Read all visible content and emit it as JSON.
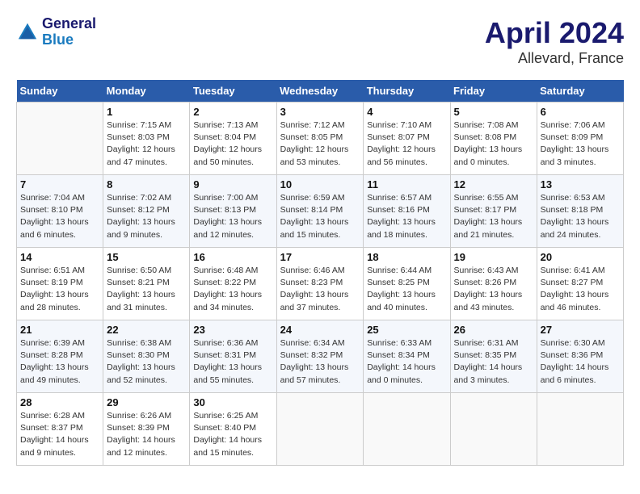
{
  "header": {
    "logo_line1": "General",
    "logo_line2": "Blue",
    "title": "April 2024",
    "subtitle": "Allevard, France"
  },
  "days_of_week": [
    "Sunday",
    "Monday",
    "Tuesday",
    "Wednesday",
    "Thursday",
    "Friday",
    "Saturday"
  ],
  "weeks": [
    [
      {
        "day": "",
        "empty": true
      },
      {
        "day": "1",
        "sunrise": "7:15 AM",
        "sunset": "8:03 PM",
        "daylight": "Daylight: 12 hours and 47 minutes."
      },
      {
        "day": "2",
        "sunrise": "7:13 AM",
        "sunset": "8:04 PM",
        "daylight": "Daylight: 12 hours and 50 minutes."
      },
      {
        "day": "3",
        "sunrise": "7:12 AM",
        "sunset": "8:05 PM",
        "daylight": "Daylight: 12 hours and 53 minutes."
      },
      {
        "day": "4",
        "sunrise": "7:10 AM",
        "sunset": "8:07 PM",
        "daylight": "Daylight: 12 hours and 56 minutes."
      },
      {
        "day": "5",
        "sunrise": "7:08 AM",
        "sunset": "8:08 PM",
        "daylight": "Daylight: 13 hours and 0 minutes."
      },
      {
        "day": "6",
        "sunrise": "7:06 AM",
        "sunset": "8:09 PM",
        "daylight": "Daylight: 13 hours and 3 minutes."
      }
    ],
    [
      {
        "day": "7",
        "sunrise": "7:04 AM",
        "sunset": "8:10 PM",
        "daylight": "Daylight: 13 hours and 6 minutes."
      },
      {
        "day": "8",
        "sunrise": "7:02 AM",
        "sunset": "8:12 PM",
        "daylight": "Daylight: 13 hours and 9 minutes."
      },
      {
        "day": "9",
        "sunrise": "7:00 AM",
        "sunset": "8:13 PM",
        "daylight": "Daylight: 13 hours and 12 minutes."
      },
      {
        "day": "10",
        "sunrise": "6:59 AM",
        "sunset": "8:14 PM",
        "daylight": "Daylight: 13 hours and 15 minutes."
      },
      {
        "day": "11",
        "sunrise": "6:57 AM",
        "sunset": "8:16 PM",
        "daylight": "Daylight: 13 hours and 18 minutes."
      },
      {
        "day": "12",
        "sunrise": "6:55 AM",
        "sunset": "8:17 PM",
        "daylight": "Daylight: 13 hours and 21 minutes."
      },
      {
        "day": "13",
        "sunrise": "6:53 AM",
        "sunset": "8:18 PM",
        "daylight": "Daylight: 13 hours and 24 minutes."
      }
    ],
    [
      {
        "day": "14",
        "sunrise": "6:51 AM",
        "sunset": "8:19 PM",
        "daylight": "Daylight: 13 hours and 28 minutes."
      },
      {
        "day": "15",
        "sunrise": "6:50 AM",
        "sunset": "8:21 PM",
        "daylight": "Daylight: 13 hours and 31 minutes."
      },
      {
        "day": "16",
        "sunrise": "6:48 AM",
        "sunset": "8:22 PM",
        "daylight": "Daylight: 13 hours and 34 minutes."
      },
      {
        "day": "17",
        "sunrise": "6:46 AM",
        "sunset": "8:23 PM",
        "daylight": "Daylight: 13 hours and 37 minutes."
      },
      {
        "day": "18",
        "sunrise": "6:44 AM",
        "sunset": "8:25 PM",
        "daylight": "Daylight: 13 hours and 40 minutes."
      },
      {
        "day": "19",
        "sunrise": "6:43 AM",
        "sunset": "8:26 PM",
        "daylight": "Daylight: 13 hours and 43 minutes."
      },
      {
        "day": "20",
        "sunrise": "6:41 AM",
        "sunset": "8:27 PM",
        "daylight": "Daylight: 13 hours and 46 minutes."
      }
    ],
    [
      {
        "day": "21",
        "sunrise": "6:39 AM",
        "sunset": "8:28 PM",
        "daylight": "Daylight: 13 hours and 49 minutes."
      },
      {
        "day": "22",
        "sunrise": "6:38 AM",
        "sunset": "8:30 PM",
        "daylight": "Daylight: 13 hours and 52 minutes."
      },
      {
        "day": "23",
        "sunrise": "6:36 AM",
        "sunset": "8:31 PM",
        "daylight": "Daylight: 13 hours and 55 minutes."
      },
      {
        "day": "24",
        "sunrise": "6:34 AM",
        "sunset": "8:32 PM",
        "daylight": "Daylight: 13 hours and 57 minutes."
      },
      {
        "day": "25",
        "sunrise": "6:33 AM",
        "sunset": "8:34 PM",
        "daylight": "Daylight: 14 hours and 0 minutes."
      },
      {
        "day": "26",
        "sunrise": "6:31 AM",
        "sunset": "8:35 PM",
        "daylight": "Daylight: 14 hours and 3 minutes."
      },
      {
        "day": "27",
        "sunrise": "6:30 AM",
        "sunset": "8:36 PM",
        "daylight": "Daylight: 14 hours and 6 minutes."
      }
    ],
    [
      {
        "day": "28",
        "sunrise": "6:28 AM",
        "sunset": "8:37 PM",
        "daylight": "Daylight: 14 hours and 9 minutes."
      },
      {
        "day": "29",
        "sunrise": "6:26 AM",
        "sunset": "8:39 PM",
        "daylight": "Daylight: 14 hours and 12 minutes."
      },
      {
        "day": "30",
        "sunrise": "6:25 AM",
        "sunset": "8:40 PM",
        "daylight": "Daylight: 14 hours and 15 minutes."
      },
      {
        "day": "",
        "empty": true
      },
      {
        "day": "",
        "empty": true
      },
      {
        "day": "",
        "empty": true
      },
      {
        "day": "",
        "empty": true
      }
    ]
  ]
}
